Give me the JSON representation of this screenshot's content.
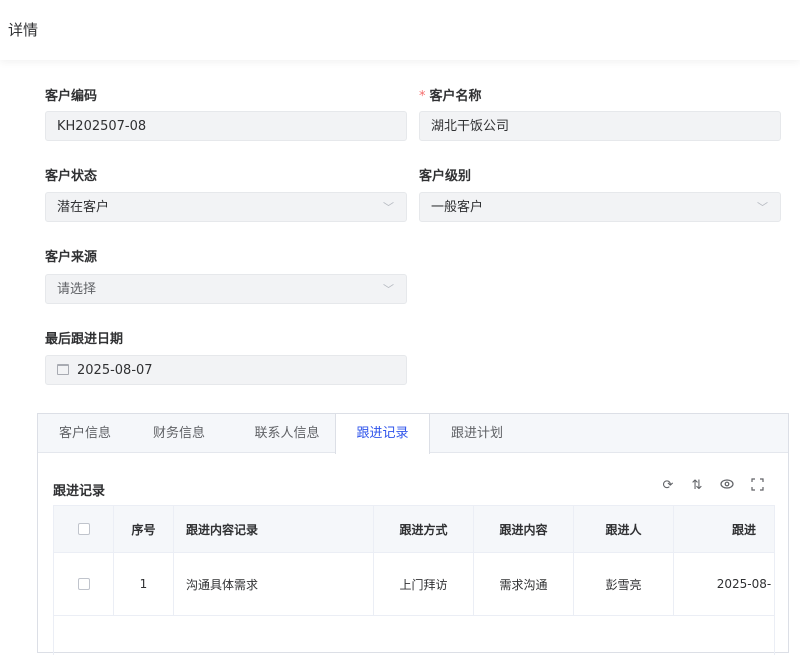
{
  "page": {
    "title": "详情"
  },
  "form": {
    "code": {
      "label": "客户编码",
      "value": "KH202507-08"
    },
    "name": {
      "required_mark": "*",
      "label": "客户名称",
      "value": "湖北干饭公司"
    },
    "status": {
      "label": "客户状态",
      "value": "潜在客户"
    },
    "level": {
      "label": "客户级别",
      "value": "一般客户"
    },
    "source": {
      "label": "客户来源",
      "placeholder": "请选择"
    },
    "last_follow_date": {
      "label": "最后跟进日期",
      "value": "2025-08-07"
    }
  },
  "tabs": [
    {
      "label": "客户信息",
      "active": false
    },
    {
      "label": "财务信息",
      "active": false
    },
    {
      "label": "联系人信息",
      "active": false
    },
    {
      "label": "跟进记录",
      "active": true
    },
    {
      "label": "跟进计划",
      "active": false
    }
  ],
  "records": {
    "title": "跟进记录",
    "toolbar_icons": [
      "refresh-icon",
      "column-height-icon",
      "eye-icon",
      "fullscreen-icon"
    ],
    "columns": [
      "",
      "序号",
      "跟进内容记录",
      "跟进方式",
      "跟进内容",
      "跟进人",
      "跟进"
    ],
    "rows": [
      {
        "index": "1",
        "content": "沟通具体需求",
        "method": "上门拜访",
        "topic": "需求沟通",
        "person": "彭雪亮",
        "date": "2025-08-"
      }
    ]
  },
  "colors": {
    "accent": "#2f54eb",
    "required": "#f56c6c"
  }
}
